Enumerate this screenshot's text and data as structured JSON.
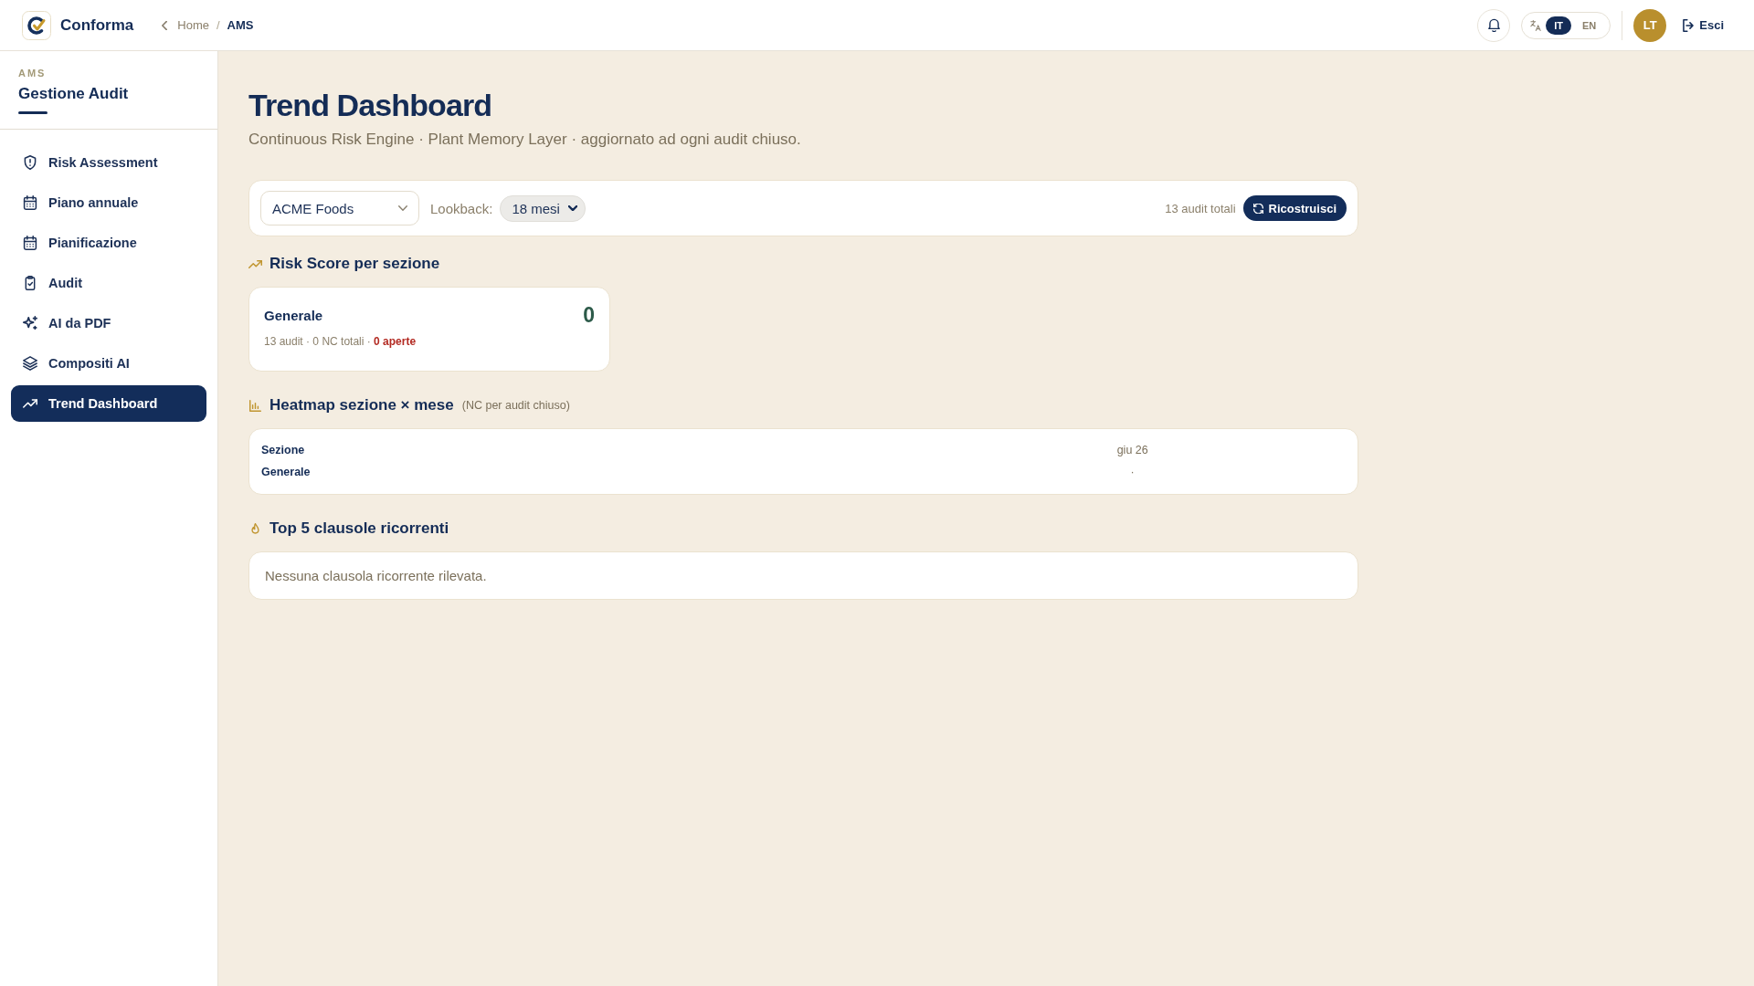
{
  "header": {
    "brand": "Conforma",
    "breadcrumb_separator": "/",
    "breadcrumb": [
      {
        "label": "Home",
        "current": false
      },
      {
        "label": "AMS",
        "current": true
      }
    ],
    "languages": [
      {
        "label": "IT",
        "selected": true
      },
      {
        "label": "EN",
        "selected": false
      }
    ],
    "avatar": "LT",
    "logout": "Esci"
  },
  "sidebar": {
    "eyebrow": "AMS",
    "title": "Gestione Audit",
    "items": [
      {
        "label": "Risk Assessment",
        "selected": false
      },
      {
        "label": "Piano annuale",
        "selected": false
      },
      {
        "label": "Pianificazione",
        "selected": false
      },
      {
        "label": "Audit",
        "selected": false
      },
      {
        "label": "AI da PDF",
        "selected": false
      },
      {
        "label": "Compositi AI",
        "selected": false
      },
      {
        "label": "Trend Dashboard",
        "selected": true
      }
    ]
  },
  "page": {
    "title": "Trend Dashboard",
    "subtitle": "Continuous Risk Engine · Plant Memory Layer · aggiornato ad ogni audit chiuso."
  },
  "filters": {
    "plant": "ACME Foods",
    "lookback_label": "Lookback:",
    "lookback": "18 mesi",
    "total": "13 audit totali",
    "rebuild_button": "Ricostruisci"
  },
  "risk_scores": {
    "title": "Risk Score per sezione",
    "cards": [
      {
        "section": "Generale",
        "score": "0",
        "meta": "13 audit · 0 NC totali ·",
        "open": "0 aperte"
      }
    ]
  },
  "heatmap": {
    "title": "Heatmap sezione × mese",
    "note": "(NC per audit chiuso)",
    "columns": [
      "Sezione",
      "giu 26"
    ],
    "rows": [
      {
        "cells": [
          "Generale",
          "·"
        ]
      }
    ]
  },
  "top_clauses": {
    "title": "Top 5 clausole ricorrenti",
    "empty": "Nessuna clausola ricorrente rilevata."
  }
}
